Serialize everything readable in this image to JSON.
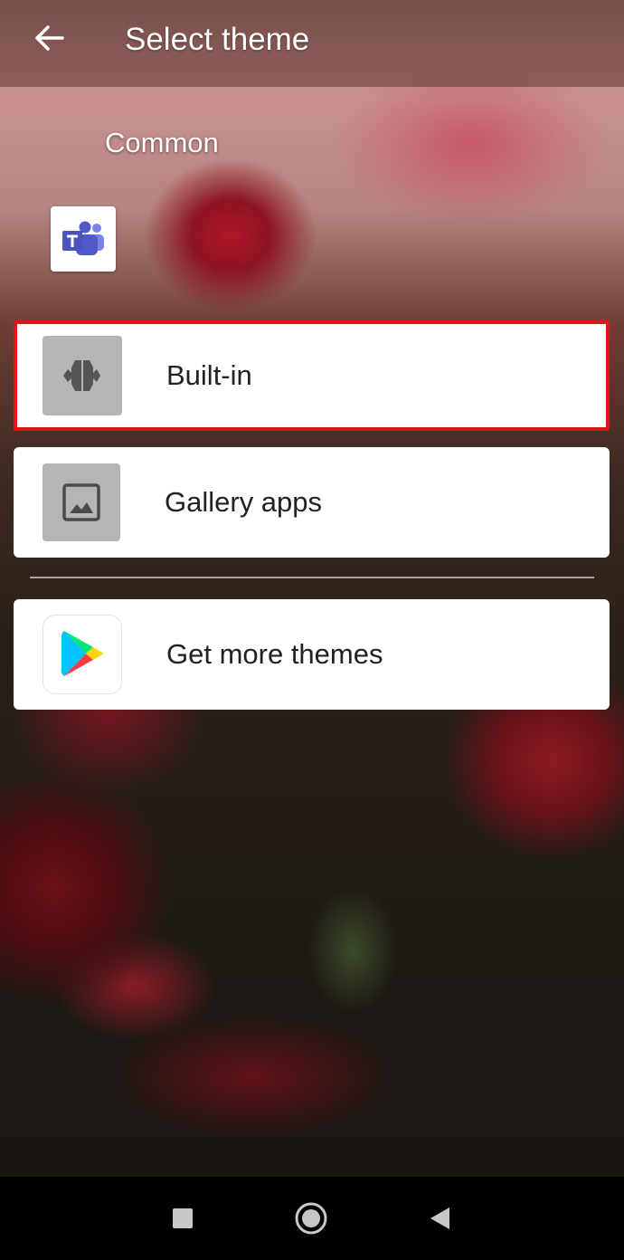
{
  "header": {
    "title": "Select theme",
    "back_icon": "arrow-left-icon"
  },
  "section": {
    "label": "Common",
    "app_icon": "microsoft-teams-icon"
  },
  "options": [
    {
      "label": "Built-in",
      "icon": "built-in-theme-icon",
      "selected": true
    },
    {
      "label": "Gallery apps",
      "icon": "image-gallery-icon",
      "selected": false
    },
    {
      "label": "Get more themes",
      "icon": "google-play-icon",
      "selected": false
    }
  ],
  "highlight_color": "#e01616",
  "system_nav": {
    "buttons": [
      "recents-square-icon",
      "home-circle-icon",
      "back-triangle-icon"
    ]
  }
}
